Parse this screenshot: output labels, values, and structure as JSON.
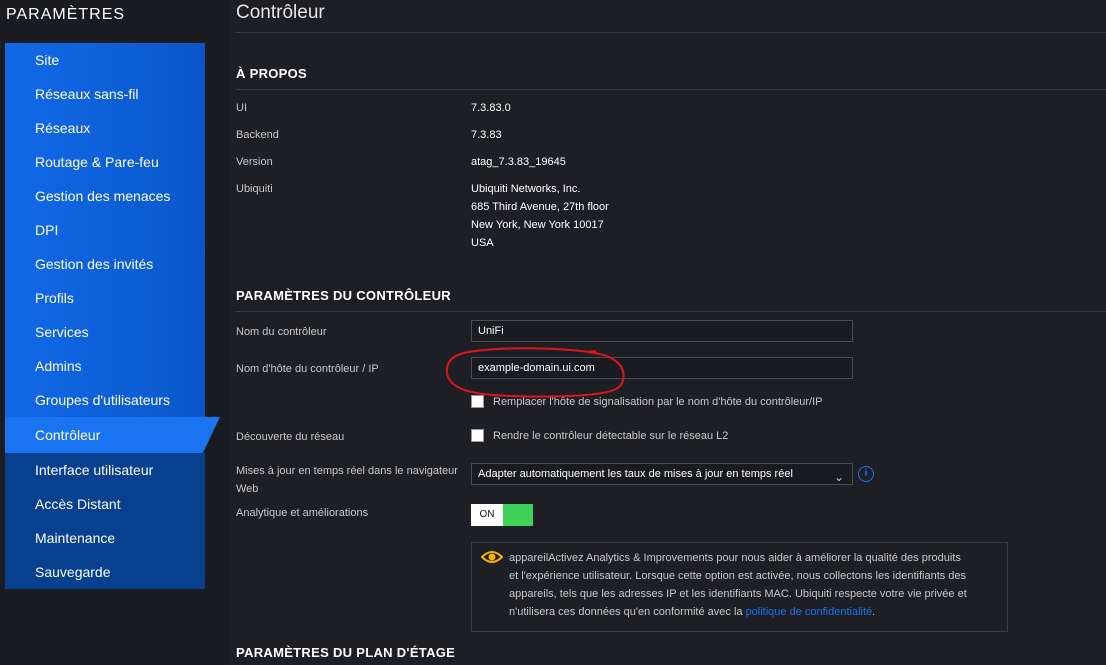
{
  "sidebar": {
    "title": "PARAMÈTRES",
    "items": [
      {
        "label": "Site"
      },
      {
        "label": "Réseaux sans-fil"
      },
      {
        "label": "Réseaux"
      },
      {
        "label": "Routage & Pare-feu"
      },
      {
        "label": "Gestion des menaces"
      },
      {
        "label": "DPI"
      },
      {
        "label": "Gestion des invités"
      },
      {
        "label": "Profils"
      },
      {
        "label": "Services"
      },
      {
        "label": "Admins"
      },
      {
        "label": "Groupes d'utilisateurs"
      },
      {
        "label": "Contrôleur"
      },
      {
        "label": "Interface utilisateur"
      },
      {
        "label": "Accès Distant"
      },
      {
        "label": "Maintenance"
      },
      {
        "label": "Sauvegarde"
      }
    ],
    "active": "Contrôleur"
  },
  "page": {
    "title": "Contrôleur"
  },
  "about": {
    "title": "À PROPOS",
    "rows": [
      {
        "label": "UI",
        "value": "7.3.83.0"
      },
      {
        "label": "Backend",
        "value": "7.3.83"
      },
      {
        "label": "Version",
        "value": "atag_7.3.83_19645"
      },
      {
        "label": "Ubiquiti",
        "lines": [
          "Ubiquiti Networks, Inc.",
          "685 Third Avenue, 27th floor",
          "New York, New York 10017",
          "USA"
        ]
      }
    ]
  },
  "controller": {
    "title": "PARAMÈTRES DU CONTRÔLEUR",
    "name_label": "Nom du contrôleur",
    "name_value": "UniFi",
    "hostname_label": "Nom d'hôte du contrôleur / IP",
    "hostname_value": "example-domain.ui.com",
    "override_label": "Remplacer l'hôte de signalisation par le nom d'hôte du contrôleur/IP",
    "discovery_label": "Découverte du réseau",
    "discovery_checkbox": "Rendre le contrôleur détectable sur le réseau L2",
    "realtime_label_1": "Mises à jour en temps réel dans le navigateur",
    "realtime_label_2": "Web",
    "realtime_value": "Adapter automatiquement les taux de mises à jour en temps réel",
    "analytics_label": "Analytique et améliorations",
    "analytics_toggle": "ON",
    "notice_lines": [
      "appareilActivez Analytics & Improvements pour nous aider à améliorer la qualité des produits",
      "et l'expérience utilisateur. Lorsque cette option est activée, nous collectons les identifiants des",
      "appareils, tels que les adresses IP et les identifiants MAC. Ubiquiti respecte votre vie privée et",
      "n'utilisera ces données qu'en conformité avec la "
    ],
    "notice_link": "politique de confidentialité",
    "notice_end": "."
  },
  "floorplan": {
    "title": "PARAMÈTRES DU PLAN D'ÉTAGE"
  },
  "colors": {
    "accent": "#1a73f0",
    "toggle_on": "#3fd35a",
    "annotation": "#e0141e"
  },
  "icons": {
    "info": "info-icon",
    "eye": "eye-icon",
    "chevron": "chevron-down-icon"
  }
}
